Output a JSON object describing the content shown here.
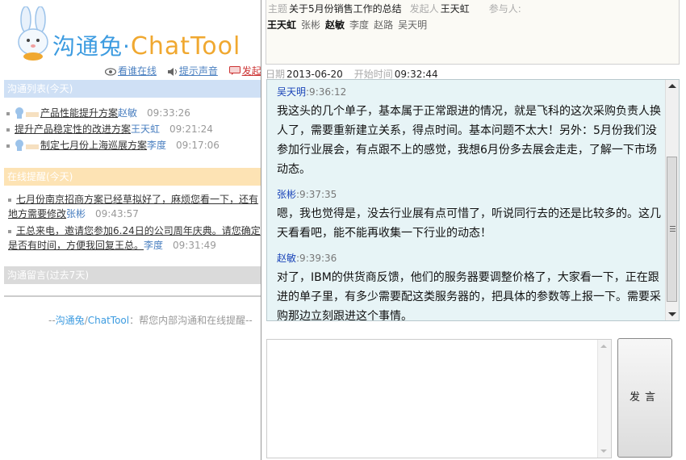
{
  "logo": {
    "brand_cn": "沟通兔",
    "brand_dot": "·",
    "brand_en": "ChatTool"
  },
  "toolbar": {
    "online_label": "看谁在线",
    "sound_label": "提示声音",
    "chat_label": "发起"
  },
  "sections": {
    "list_head": "沟通列表(今天)",
    "remind_head": "在线提醒(今天)",
    "msg_head": "沟通留言(过去7天)"
  },
  "chat_list": [
    {
      "title": "产品性能提升方案",
      "person": "赵敏",
      "time": "09:33:26"
    },
    {
      "title": "提升产品稳定性的改进方案",
      "person": "王天虹",
      "time": "09:21:24"
    },
    {
      "title": "制定七月份上海巡展方案",
      "person": "李度",
      "time": "09:17:06"
    }
  ],
  "reminders": [
    {
      "line1": "七月份南京招商方案已经草拟好了，麻烦您看一下，还有",
      "line2": "地方需要修改",
      "person": "张彬",
      "time": "09:43:57"
    },
    {
      "line1": "王总来电，邀请您参加6.24日的公司周年庆典。请您确定",
      "line2": "是否有时间，方便我回复王总。",
      "person": "李度",
      "time": "09:31:49"
    }
  ],
  "footer": {
    "prefix": "--",
    "cn": "沟通兔",
    "slash": "/",
    "en": "ChatTool",
    "suffix": "：帮您内部沟通和在线提醒--"
  },
  "dialog": {
    "subject_label": "主题",
    "subject": "关于5月份销售工作的总结",
    "initiator_label": "发起人",
    "initiator": "王天虹",
    "participants_label": "参与人:",
    "participants": [
      {
        "name": "王天虹",
        "bold": true
      },
      {
        "name": "张彬",
        "bold": false
      },
      {
        "name": "赵敏",
        "bold": true
      },
      {
        "name": "李度",
        "bold": false
      },
      {
        "name": "赵路",
        "bold": false
      },
      {
        "name": "吴天明",
        "bold": false
      }
    ],
    "date_label": "日期",
    "date": "2013-06-20",
    "start_label": "开始时间",
    "start_time": "09:32:44",
    "messages": [
      {
        "name": "吴天明",
        "time": ":9:36:12",
        "text": "我这头的几个单子，基本属于正常跟进的情况，就是飞科的这次采购负责人换人了，需要重新建立关系，得点时间。基本问题不太大！另外：5月份我们没参加行业展会，有点跟不上的感觉，我想6月份多去展会走走，了解一下市场动态。"
      },
      {
        "name": "张彬",
        "time": ":9:37:35",
        "text": "嗯，我也觉得是，没去行业展有点可惜了，听说同行去的还是比较多的。这几天看看吧，能不能再收集一下行业的动态！"
      },
      {
        "name": "赵敏",
        "time": ":9:39:36",
        "text": "对了，IBM的供货商反馈，他们的服务器要调整价格了，大家看一下，正在跟进的单子里，有多少需要配这类服务器的，把具体的参数等上报一下。需要采购那边立刻跟进这个事情。"
      }
    ],
    "input_value": "",
    "send_label": "发言"
  },
  "colors": {
    "brand_blue": "#3c9be0",
    "brand_orange": "#f0a830",
    "link_blue": "#4a7fc0",
    "msg_bg": "#e7f4f6"
  }
}
